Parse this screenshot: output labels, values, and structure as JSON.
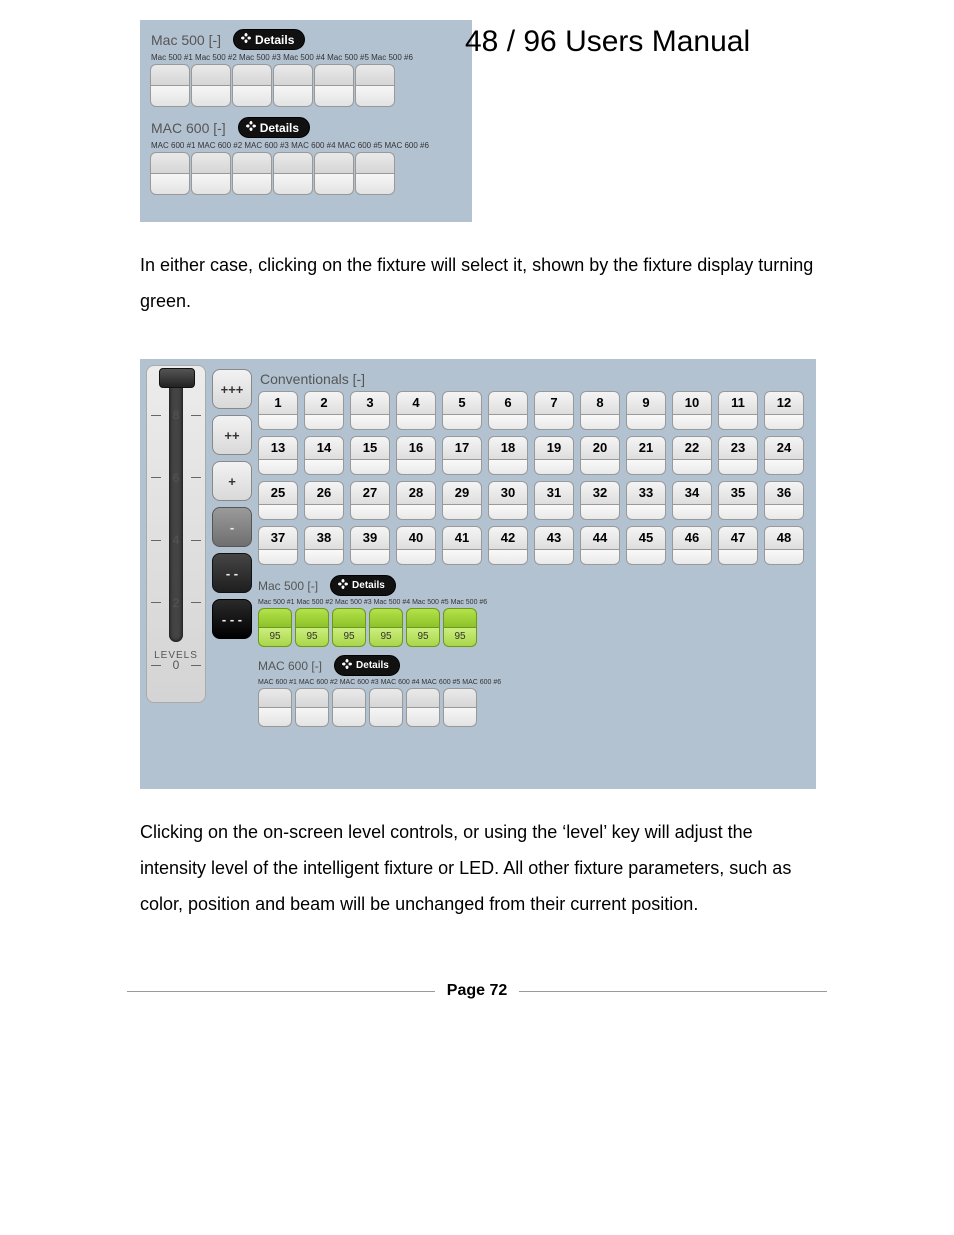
{
  "title": "48 / 96 Users Manual",
  "panel1": {
    "group1": {
      "title": "Mac 500 [-]",
      "details": "Details",
      "labels": "Mac 500 #1 Mac 500 #2 Mac 500 #3 Mac 500 #4 Mac 500 #5 Mac 500 #6",
      "count": 6
    },
    "group2": {
      "title": "MAC 600 [-]",
      "details": "Details",
      "labels": "MAC 600 #1 MAC 600 #2 MAC 600 #3 MAC 600 #4 MAC 600 #5 MAC 600 #6",
      "count": 6
    }
  },
  "para1": "In either case, clicking on the fixture will select it, shown by the fixture display turning green.",
  "panel2": {
    "gauge": {
      "ticks": [
        "8",
        "6",
        "4",
        "2",
        "0"
      ],
      "label": "LEVELS"
    },
    "steppers": [
      "+++",
      "++",
      "+",
      "-",
      "- -",
      "- - -"
    ],
    "conv": {
      "title": "Conventionals [-]",
      "first": 1,
      "last": 48
    },
    "mac500": {
      "title": "Mac 500 [-]",
      "details": "Details",
      "labels": "Mac 500 #1 Mac 500 #2 Mac 500 #3 Mac 500 #4 Mac 500 #5 Mac 500 #6",
      "selected": true,
      "value": "95",
      "count": 6
    },
    "mac600": {
      "title": "MAC 600 [-]",
      "details": "Details",
      "labels": "MAC 600 #1 MAC 600 #2 MAC 600 #3 MAC 600 #4 MAC 600 #5 MAC 600 #6",
      "selected": false,
      "count": 6
    }
  },
  "para2": "Clicking on the on-screen level controls, or using the ‘level’ key will adjust the intensity level of the intelligent fixture or LED.  All other fixture parameters, such as color, position and beam will be unchanged from their current position.",
  "footer": "Page 72"
}
